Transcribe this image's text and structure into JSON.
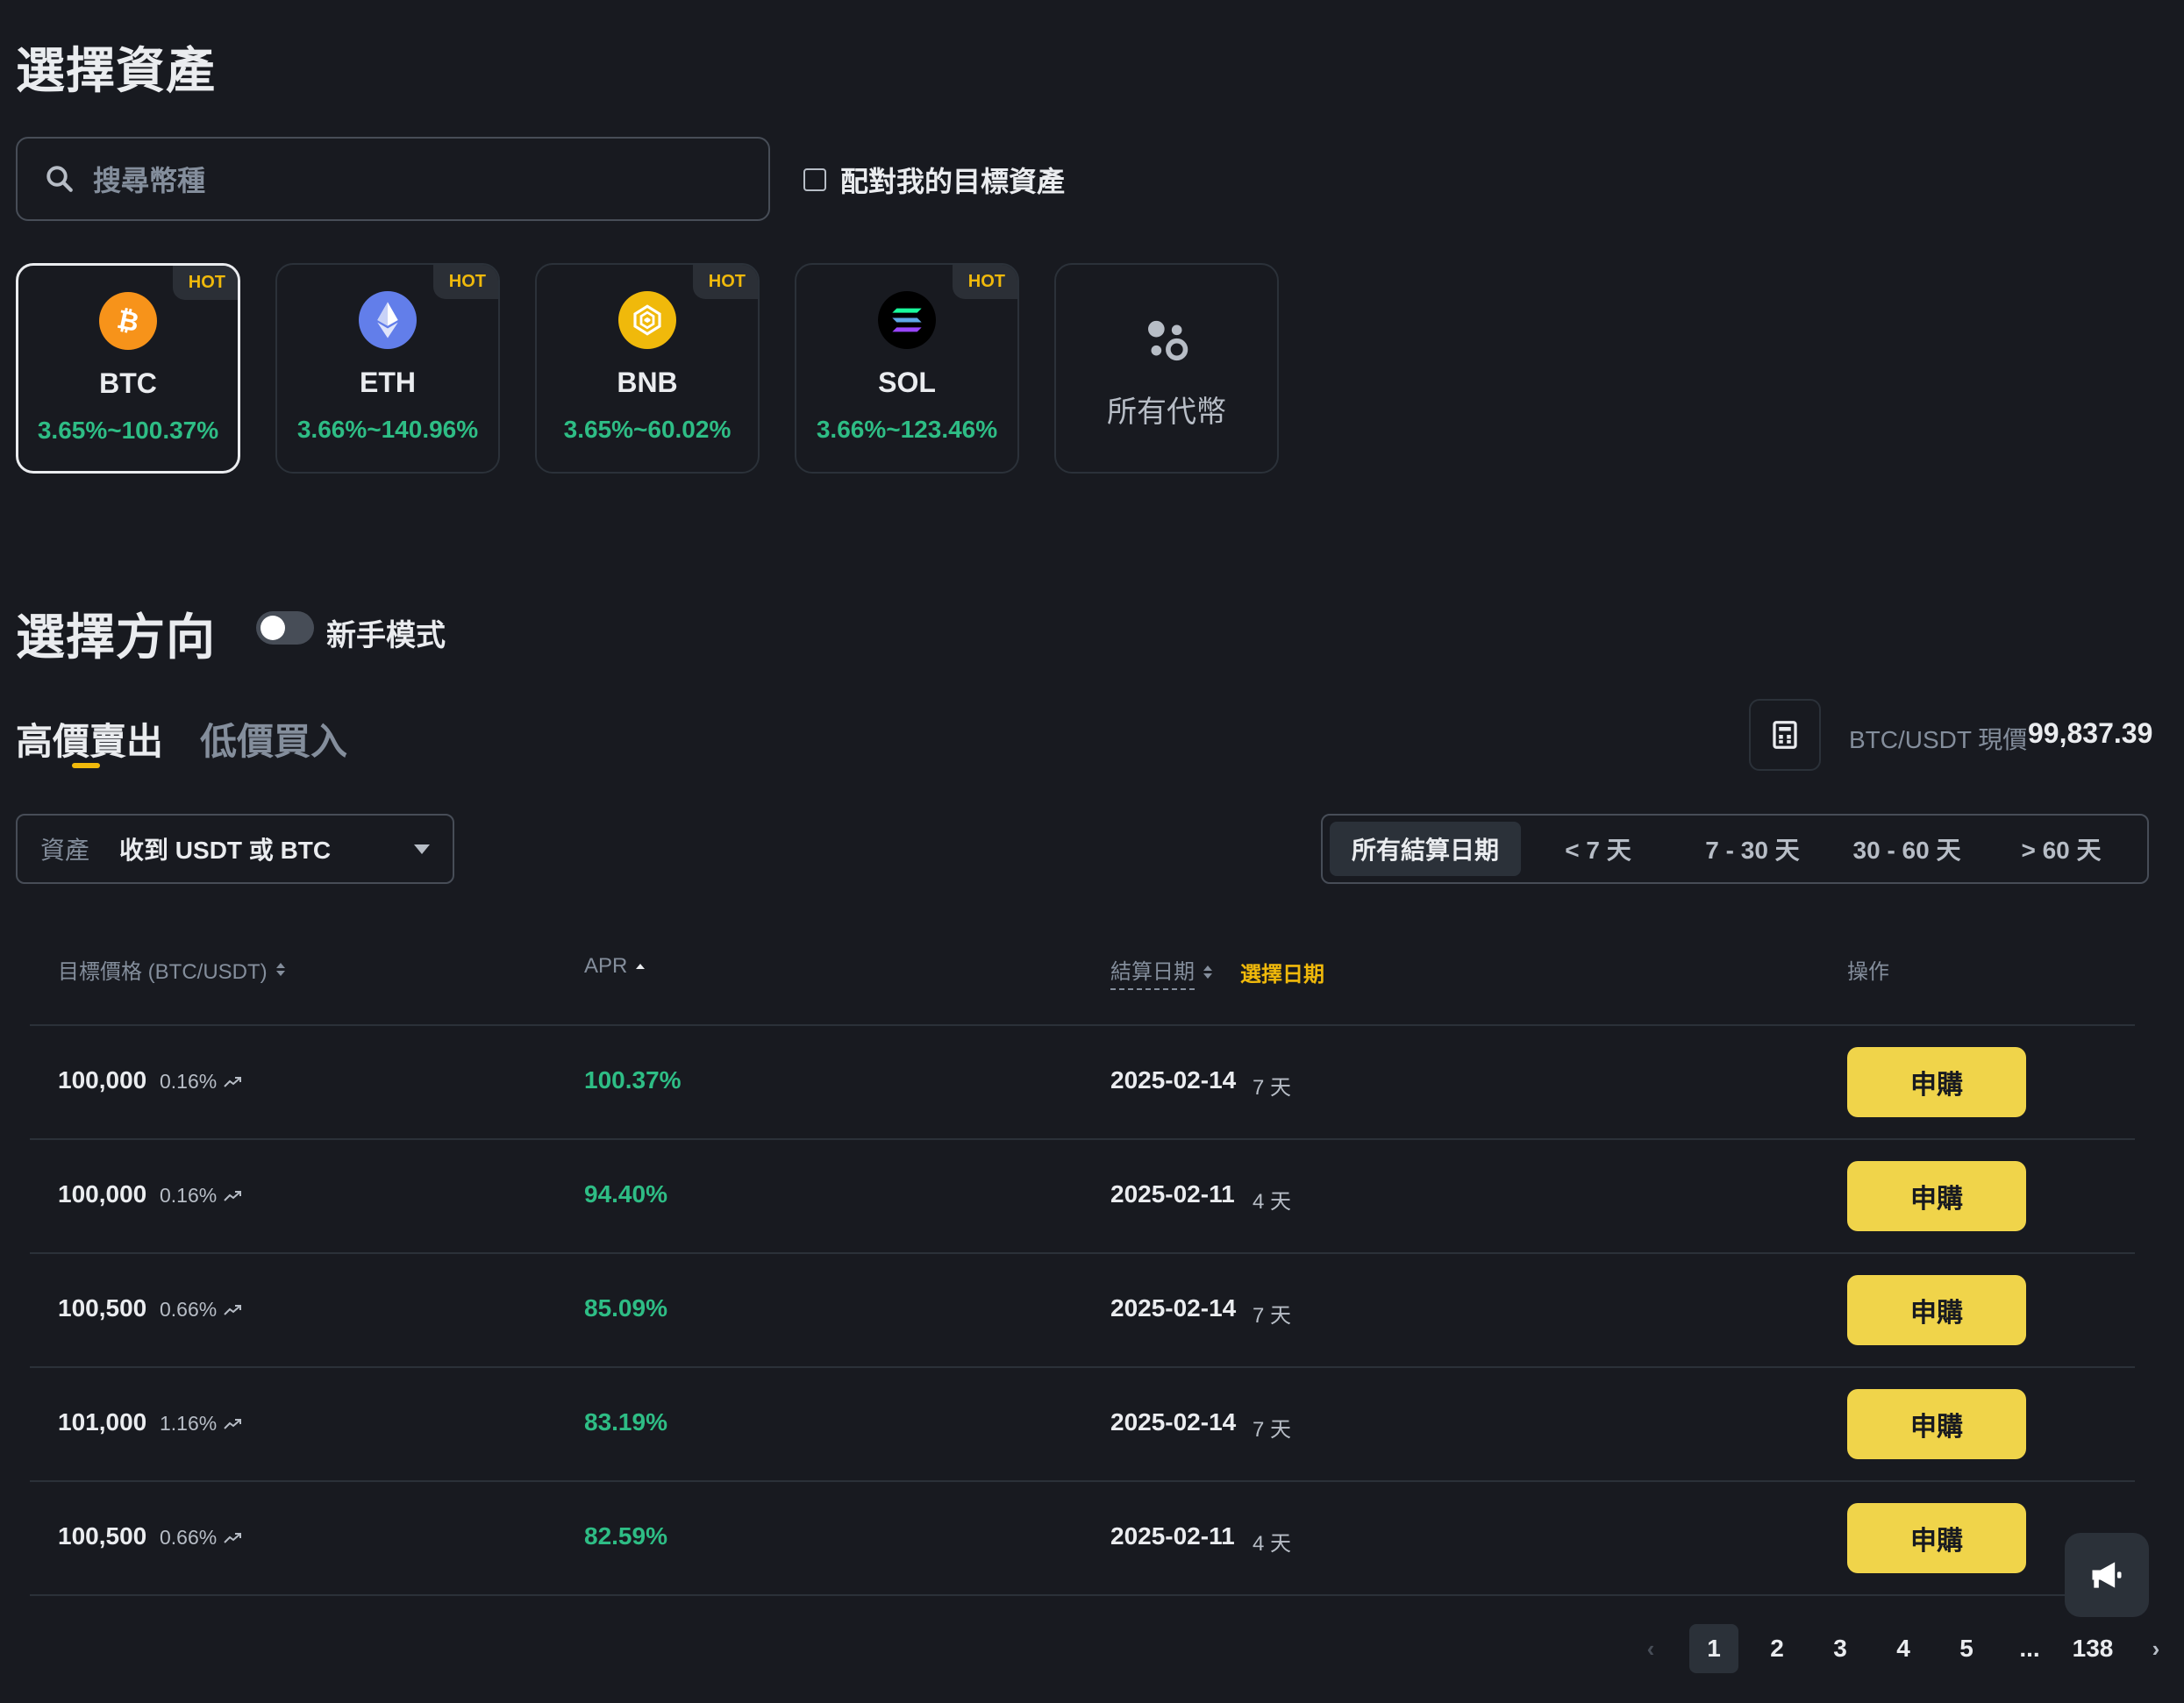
{
  "section_asset": {
    "title": "選擇資產"
  },
  "search": {
    "placeholder": "搜尋幣種"
  },
  "match_filter": {
    "label": "配對我的目標資產",
    "checked": false
  },
  "assets": [
    {
      "symbol": "BTC",
      "range": "3.65%~100.37%",
      "badge": "HOT",
      "icon": "bitcoin-icon",
      "color": "#f7931a",
      "selected": true
    },
    {
      "symbol": "ETH",
      "range": "3.66%~140.96%",
      "badge": "HOT",
      "icon": "ethereum-icon",
      "color": "#627eea",
      "selected": false
    },
    {
      "symbol": "BNB",
      "range": "3.65%~60.02%",
      "badge": "HOT",
      "icon": "bnb-icon",
      "color": "#f0b90b",
      "selected": false
    },
    {
      "symbol": "SOL",
      "range": "3.66%~123.46%",
      "badge": "HOT",
      "icon": "solana-icon",
      "color": "#000000",
      "selected": false
    }
  ],
  "all_tokens": {
    "label": "所有代幣",
    "icon": "all-tokens-icon"
  },
  "section_direction": {
    "title": "選擇方向",
    "toggle_label": "新手模式",
    "toggle_on": false
  },
  "tabs": [
    {
      "label": "高價賣出",
      "active": true
    },
    {
      "label": "低價買入",
      "active": false
    }
  ],
  "price": {
    "label": "BTC/USDT 現價",
    "value": "99,837.39"
  },
  "asset_select": {
    "key": "資產",
    "value": "收到 USDT 或 BTC"
  },
  "date_filters": [
    {
      "label": "所有結算日期",
      "active": true
    },
    {
      "label": "< 7 天",
      "active": false
    },
    {
      "label": "7 - 30 天",
      "active": false
    },
    {
      "label": "30 - 60 天",
      "active": false
    },
    {
      "label": "> 60 天",
      "active": false
    }
  ],
  "table": {
    "headers": {
      "target_price": "目標價格 (BTC/USDT)",
      "apr": "APR",
      "settle_date": "結算日期",
      "choose_date": "選擇日期",
      "action": "操作"
    },
    "rows": [
      {
        "price": "100,000",
        "pct": "0.16%",
        "apr": "100.37%",
        "date": "2025-02-14",
        "days": "7 天",
        "action": "申購"
      },
      {
        "price": "100,000",
        "pct": "0.16%",
        "apr": "94.40%",
        "date": "2025-02-11",
        "days": "4 天",
        "action": "申購"
      },
      {
        "price": "100,500",
        "pct": "0.66%",
        "apr": "85.09%",
        "date": "2025-02-14",
        "days": "7 天",
        "action": "申購"
      },
      {
        "price": "101,000",
        "pct": "1.16%",
        "apr": "83.19%",
        "date": "2025-02-14",
        "days": "7 天",
        "action": "申購"
      },
      {
        "price": "100,500",
        "pct": "0.66%",
        "apr": "82.59%",
        "date": "2025-02-11",
        "days": "4 天",
        "action": "申購"
      }
    ]
  },
  "pagination": {
    "pages": [
      "1",
      "2",
      "3",
      "4",
      "5",
      "...",
      "138"
    ],
    "current": "1",
    "prev": "‹",
    "next": "›"
  },
  "colors": {
    "accent": "#f0b90b",
    "positive": "#2ebd85",
    "button": "#f0d44a",
    "background": "#181a20"
  }
}
